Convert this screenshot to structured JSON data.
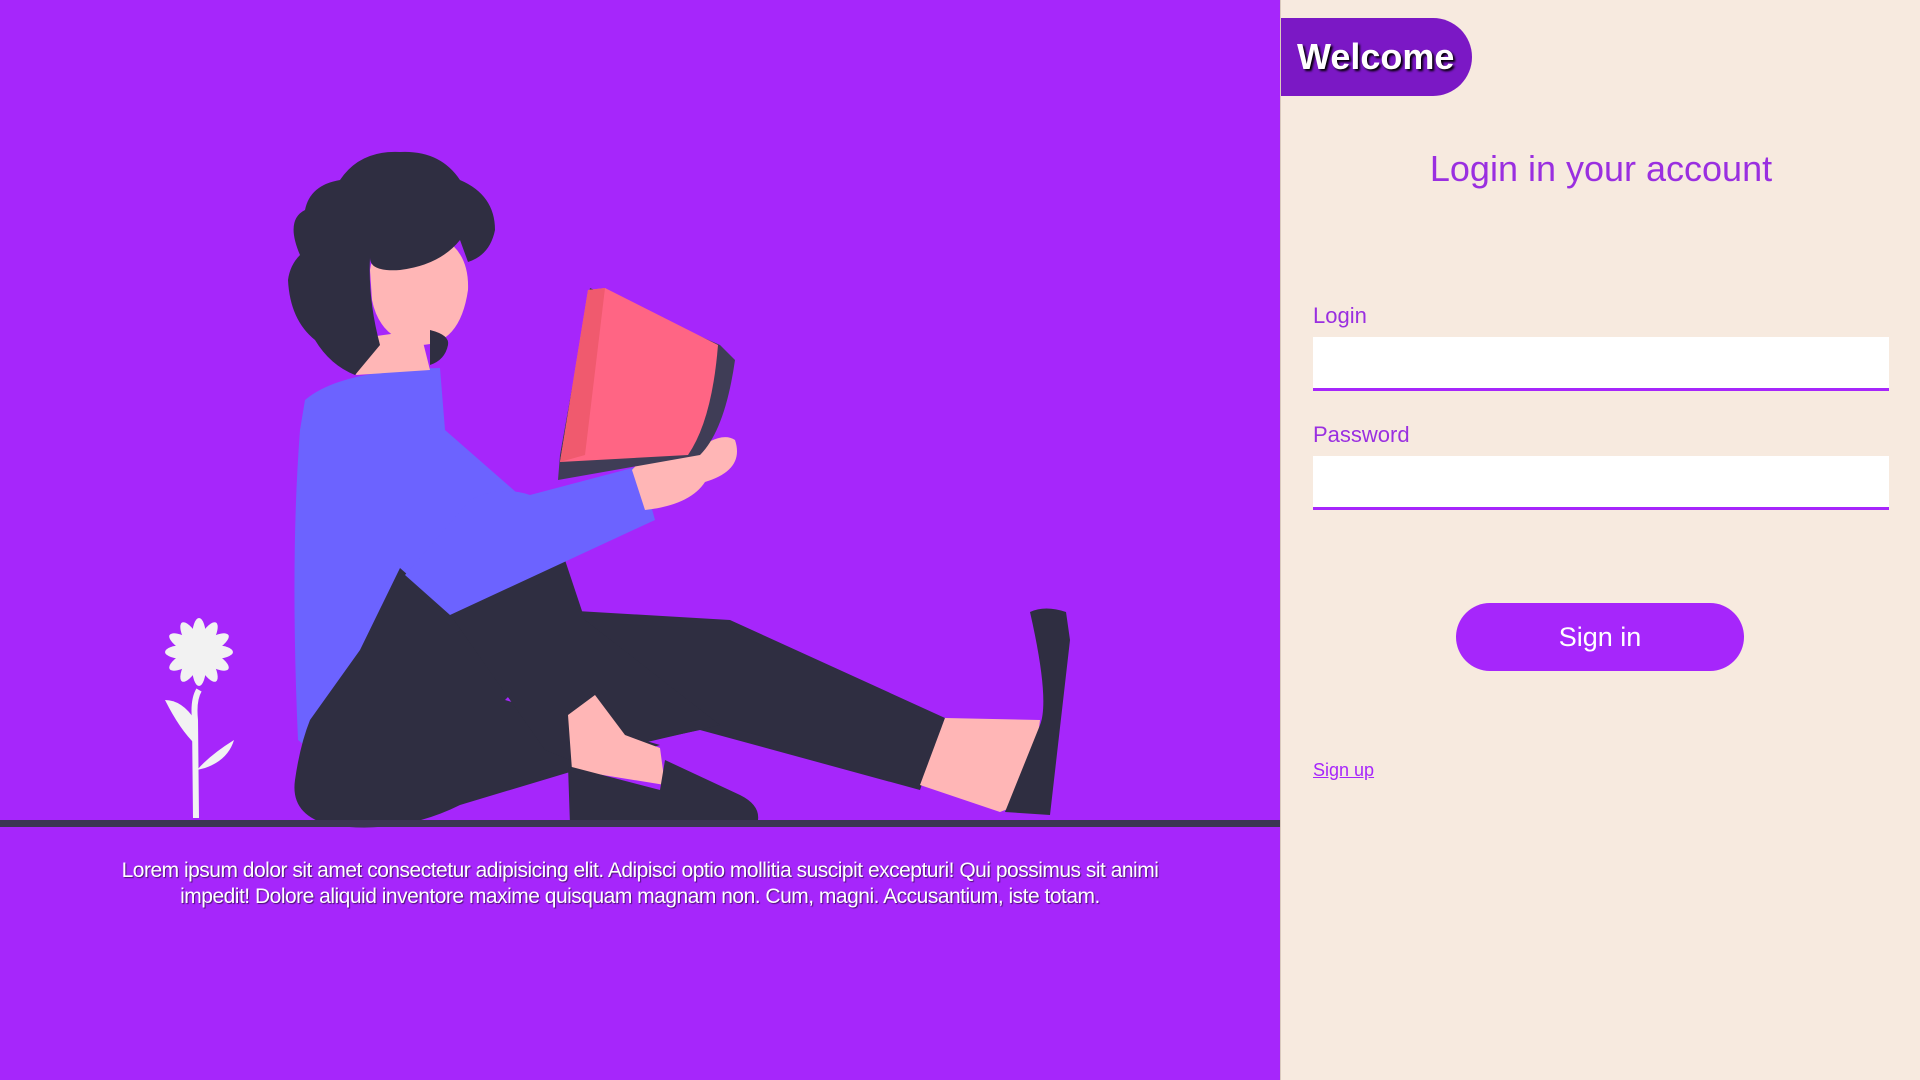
{
  "colors": {
    "left_background": "#a626fb",
    "right_background": "#f7eadf",
    "accent": "#a626fb",
    "badge": "#7b18c5",
    "title_text": "#9a2fe0"
  },
  "illustration": {
    "subject": "person-reading-book-icon",
    "flower": "flower-icon"
  },
  "left": {
    "description": "Lorem ipsum dolor sit amet consectetur adipisicing elit. Adipisci optio mollitia suscipit excepturi! Qui possimus sit animi impedit! Dolore aliquid inventore maxime quisquam magnam non. Cum, magni. Accusantium, iste totam."
  },
  "header": {
    "welcome": "Welcome"
  },
  "form": {
    "title": "Login in your account",
    "login_label": "Login",
    "login_value": "",
    "password_label": "Password",
    "password_value": "",
    "signin_label": "Sign in",
    "signup_label": "Sign up"
  }
}
